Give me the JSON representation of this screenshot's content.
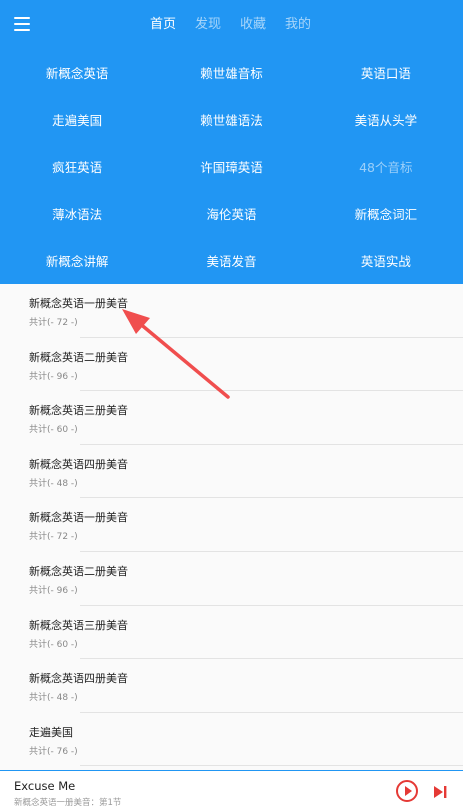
{
  "header": {
    "menu_icon": "hamburger-menu-icon",
    "tabs": [
      {
        "label": "首页",
        "active": true
      },
      {
        "label": "发现",
        "active": false
      },
      {
        "label": "收藏",
        "active": false
      },
      {
        "label": "我的",
        "active": false
      }
    ]
  },
  "categories": [
    [
      "新概念英语",
      "赖世雄音标",
      "英语口语"
    ],
    [
      "走遍美国",
      "赖世雄语法",
      "美语从头学"
    ],
    [
      "疯狂英语",
      "许国璋英语",
      "48个音标"
    ],
    [
      "薄冰语法",
      "海伦英语",
      "新概念词汇"
    ],
    [
      "新概念讲解",
      "美语发音",
      "英语实战"
    ]
  ],
  "list": {
    "items": [
      {
        "title": "新概念英语一册美音",
        "count": "共计(- 72 -)"
      },
      {
        "title": "新概念英语二册美音",
        "count": "共计(- 96 -)"
      },
      {
        "title": "新概念英语三册美音",
        "count": "共计(- 60 -)"
      },
      {
        "title": "新概念英语四册美音",
        "count": "共计(- 48 -)"
      },
      {
        "title": "新概念英语一册美音",
        "count": "共计(- 72 -)"
      },
      {
        "title": "新概念英语二册美音",
        "count": "共计(- 96 -)"
      },
      {
        "title": "新概念英语三册美音",
        "count": "共计(- 60 -)"
      },
      {
        "title": "新概念英语四册美音",
        "count": "共计(- 48 -)"
      },
      {
        "title": "走遍美国",
        "count": "共计(- 76 -)"
      }
    ]
  },
  "player": {
    "title": "Excuse Me",
    "subtitle": "新概念英语一册美音：第1节",
    "play_icon": "play-icon",
    "next_icon": "skip-next-icon"
  },
  "colors": {
    "primary": "#2196f3",
    "accent": "#e53935",
    "annotation_arrow": "#f04e4e"
  }
}
